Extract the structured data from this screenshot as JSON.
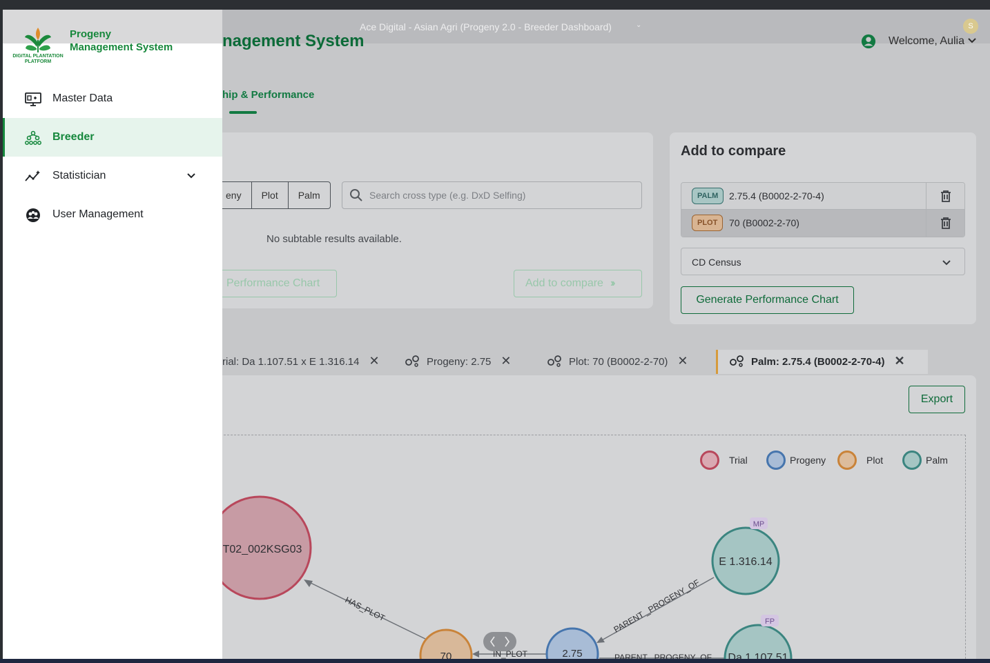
{
  "window": {
    "title": "Ace Digital - Asian Agri (Progeny 2.0 - Breeder Dashboard)",
    "avatar_initial": "S"
  },
  "header": {
    "app_title": "nagement System",
    "welcome": "Welcome, Aulia"
  },
  "tab": {
    "label": "hip & Performance"
  },
  "filter": {
    "segments": [
      "eny",
      "Plot",
      "Palm"
    ],
    "search_placeholder": "Search cross type (e.g. DxD Selfing)",
    "no_results": "No subtable results available.",
    "perf_button": "Performance Chart",
    "add_button": "Add to compare"
  },
  "compare": {
    "title": "Add to compare",
    "items": [
      {
        "badge": "PALM",
        "text": "2.75.4 (B0002-2-70-4)"
      },
      {
        "badge": "PLOT",
        "text": "70 (B0002-2-70)"
      }
    ],
    "select_value": "CD Census",
    "generate_button": "Generate Performance Chart"
  },
  "crumbs": [
    {
      "label": "rial: Da 1.107.51 x E 1.316.14",
      "close": "✕"
    },
    {
      "label": "Progeny: 2.75",
      "close": "✕"
    },
    {
      "label": "Plot: 70 (B0002-2-70)",
      "close": "✕"
    },
    {
      "label": "Palm: 2.75.4 (B0002-2-70-4)",
      "close": "✕"
    }
  ],
  "graph": {
    "export_button": "Export",
    "legend": [
      {
        "label": "Trial",
        "color": "#b8475b"
      },
      {
        "label": "Progeny",
        "color": "#4675ad"
      },
      {
        "label": "Plot",
        "color": "#c98339"
      },
      {
        "label": "Palm",
        "color": "#3b8580"
      }
    ],
    "nodes": {
      "trial": "T02_002KSG03",
      "plot": "70",
      "progeny": "2.75",
      "palm_mp": "E 1.316.14",
      "palm_fp": "Da 1.107.51"
    },
    "tags": {
      "mp": "MP",
      "fp": "FP"
    },
    "edges": {
      "has_plot": "HAS_PLOT",
      "in_plot": "IN_PLOT",
      "parent_progeny_1": "PARENT _PROGENY_OF",
      "parent_progeny_2": "PARENT _PROGENY_OF"
    }
  },
  "sidebar": {
    "brand_line1": "Progeny",
    "brand_line2": "Management System",
    "logo_caption_1": "DIGITAL PLANTATION",
    "logo_caption_2": "PLATFORM",
    "items": [
      {
        "label": "Master Data",
        "icon": "monitor-icon"
      },
      {
        "label": "Breeder",
        "icon": "hierarchy-icon",
        "active": true
      },
      {
        "label": "Statistician",
        "icon": "trend-icon",
        "expandable": true
      },
      {
        "label": "User Management",
        "icon": "users-icon"
      }
    ]
  },
  "colors": {
    "brand_green": "#16883d",
    "accent_orange": "#d69a3b"
  }
}
